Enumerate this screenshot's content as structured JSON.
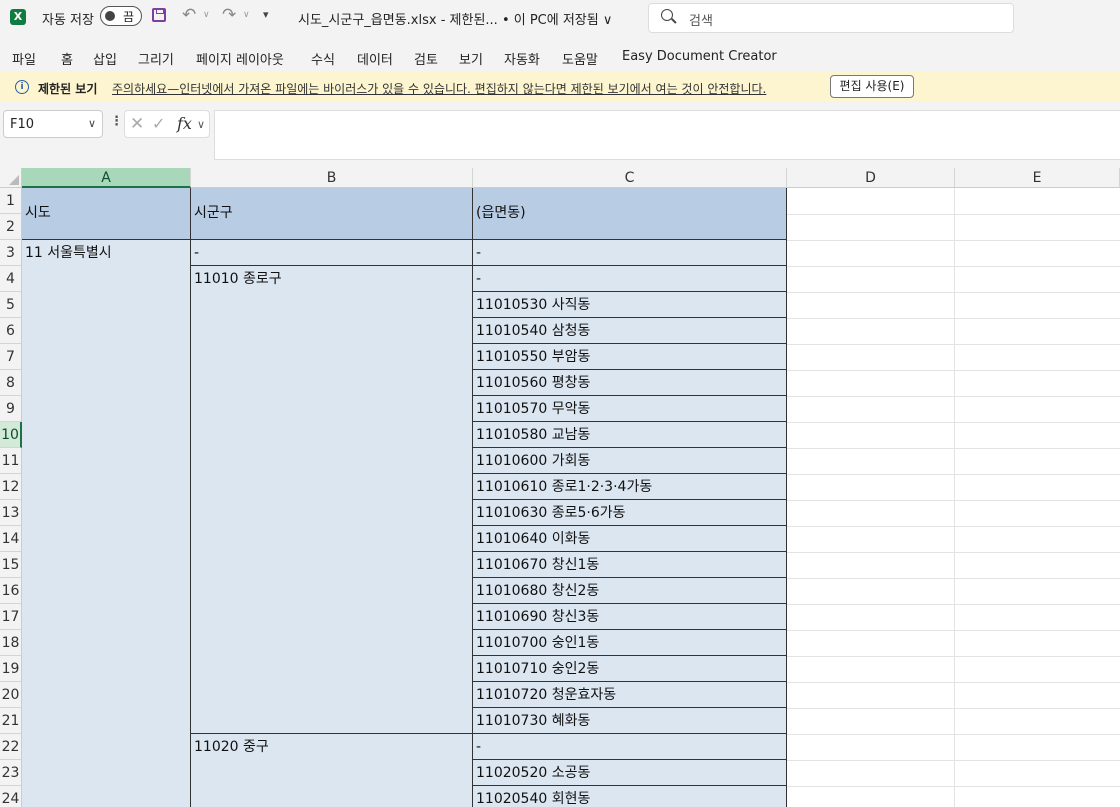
{
  "titlebar": {
    "logo": "X",
    "autosave_label": "자동 저장",
    "autosave_state": "끔",
    "doc_title": "시도_시군구_읍면동.xlsx  -  제한된...   • 이 PC에 저장됨 ∨",
    "search_placeholder": "검색"
  },
  "menu": [
    "파일",
    "홈",
    "삽입",
    "그리기",
    "페이지 레이아웃",
    "수식",
    "데이터",
    "검토",
    "보기",
    "자동화",
    "도움말",
    "Easy Document Creator"
  ],
  "message_bar": {
    "title": "제한된 보기",
    "text": "주의하세요—인터넷에서 가져온 파일에는 바이러스가 있을 수 있습니다. 편집하지 않는다면 제한된 보기에서 여는 것이 안전합니다.",
    "button": "편집 사용(E)"
  },
  "formula_bar": {
    "name_box": "F10",
    "fx": "fx",
    "formula": ""
  },
  "sheet": {
    "columns": [
      "A",
      "B",
      "C",
      "D",
      "E"
    ],
    "rows": [
      "1",
      "2",
      "3",
      "4",
      "5",
      "6",
      "7",
      "8",
      "9",
      "10",
      "11",
      "12",
      "13",
      "14",
      "15",
      "16",
      "17",
      "18",
      "19",
      "20",
      "21",
      "22",
      "23",
      "24"
    ],
    "headers": {
      "a": "시도",
      "b": "시군구",
      "c": "(읍면동)"
    },
    "a3": "11 서울특별시",
    "b3": "-",
    "b4": "11010 종로구",
    "b22": "11020 중구",
    "c_values": [
      "-",
      "-",
      "11010530 사직동",
      "11010540 삼청동",
      "11010550 부암동",
      "11010560 평창동",
      "11010570 무악동",
      "11010580 교남동",
      "11010600 가회동",
      "11010610 종로1·2·3·4가동",
      "11010630 종로5·6가동",
      "11010640 이화동",
      "11010670 창신1동",
      "11010680 창신2동",
      "11010690 창신3동",
      "11010700 숭인1동",
      "11010710 숭인2동",
      "11010720 청운효자동",
      "11010730 혜화동",
      "-",
      "11020520 소공동",
      "11020540 회현동"
    ]
  }
}
